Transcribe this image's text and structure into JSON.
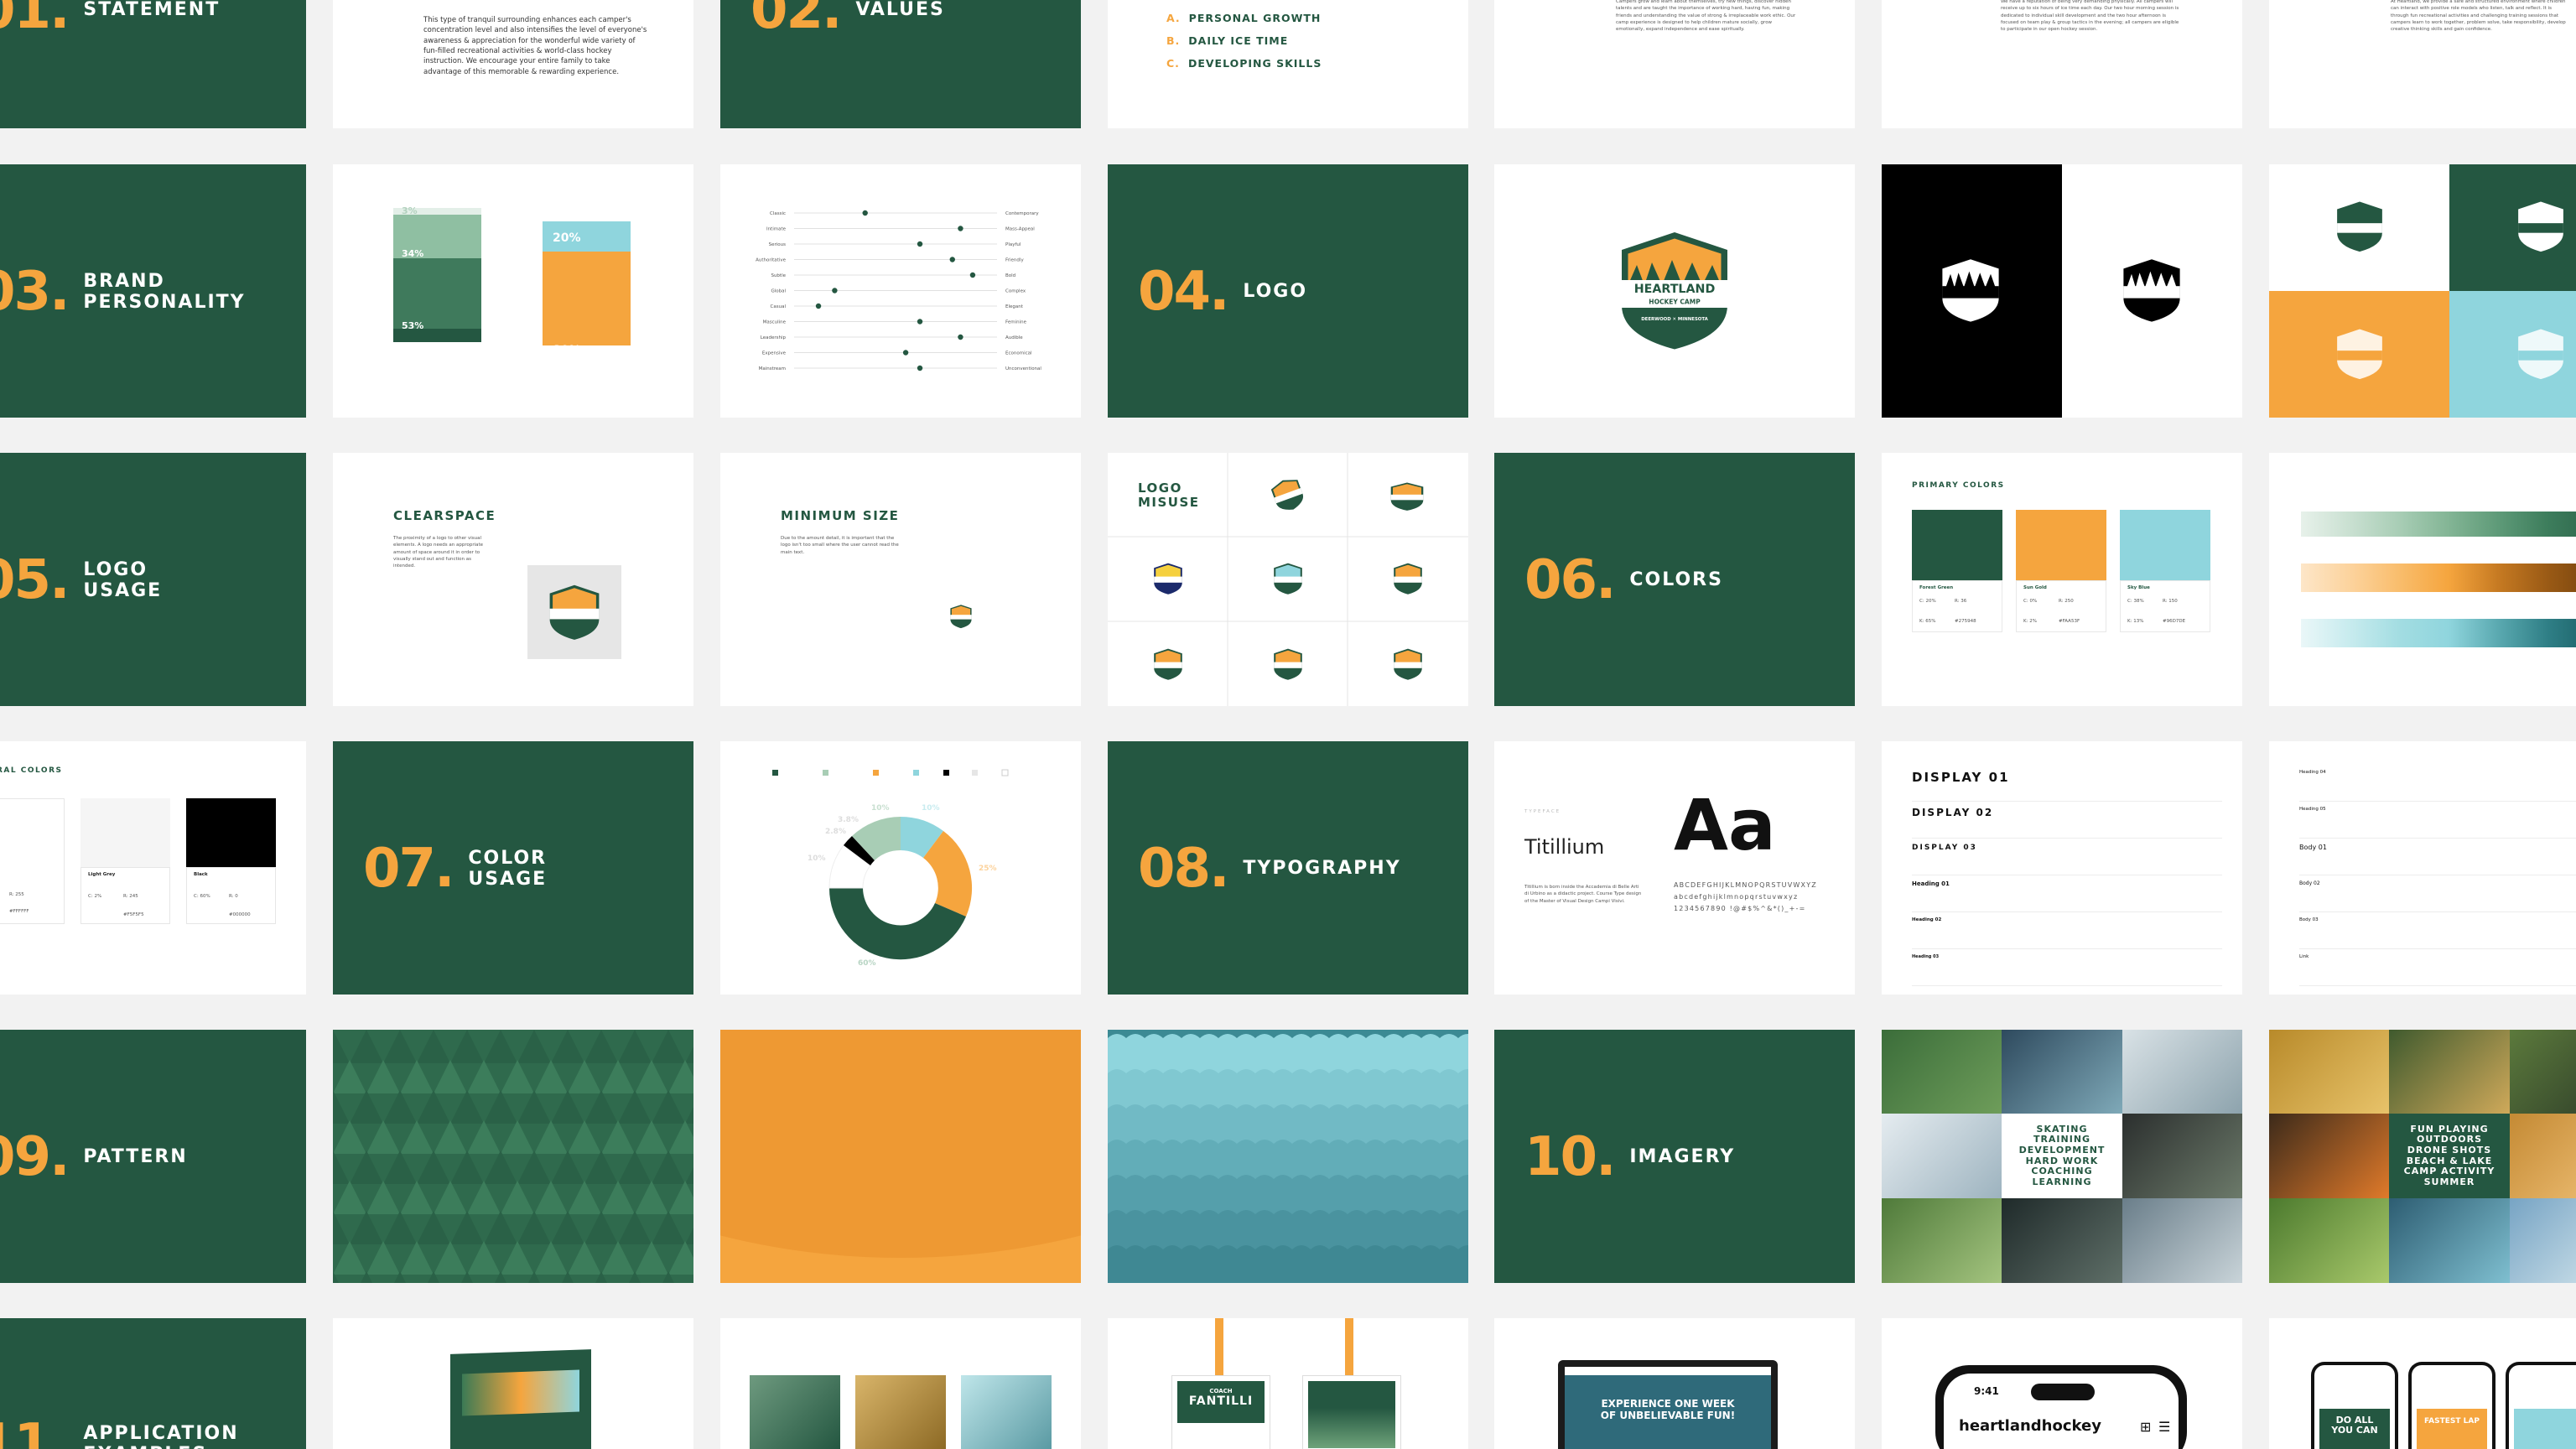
{
  "colors": {
    "forest_green": "#245741",
    "sun_gold": "#f5a53e",
    "sky_blue": "#8fd5dd",
    "black": "#000000",
    "light_grey": "#f5f5f5"
  },
  "row1": {
    "statement_title": "STATEMENT",
    "statement_number": "01.",
    "statement_text": "This type of tranquil surrounding enhances each camper's concentration level and also intensifies the level of everyone's awareness & appreciation for the wonderful wide variety of fun-filled recreational activities & world-class hockey instruction. We encourage your entire family to take advantage of this memorable & rewarding experience.",
    "values_number": "02.",
    "values_title": "VALUES",
    "values": [
      {
        "letter": "A.",
        "label": "PERSONAL GROWTH"
      },
      {
        "letter": "B.",
        "label": "DAILY ICE TIME"
      },
      {
        "letter": "C.",
        "label": "DEVELOPING SKILLS"
      }
    ],
    "value_text_a": "Campers grow and learn about themselves, try new things, discover hidden talents and are taught the importance of working hard, having fun, making friends and understanding the value of strong & irreplaceable work ethic. Our camp experience is designed to help children mature socially, grow emotionally, expand independence and ease spiritually.",
    "value_text_b": "We have a reputation of being very demanding physically. All campers will receive up to six hours of ice time each day. Our two hour morning session is dedicated to individual skill development and the two hour afternoon is focused on team play & group tactics in the evening; all campers are eligible to participate in our open hockey session.",
    "value_text_c": "At Heartland, we provide a safe and structured environment where children can interact with positive role models who listen, talk and reflect. It is through fun recreational activities and challenging training sessions that campers learn to work together, problem solve, take responsibility, develop creative thinking skills and gain confidence."
  },
  "row2": {
    "number": "03.",
    "title": "BRAND\nPERSONALITY",
    "bar_chart": {
      "bars": [
        {
          "segments": [
            {
              "label": "3%",
              "value": 3
            },
            {
              "label": "34%",
              "value": 34
            },
            {
              "label": "53%",
              "value": 53
            },
            {
              "label": "10%",
              "value": 10
            }
          ]
        },
        {
          "segments": [
            {
              "label": "20%",
              "value": 20
            },
            {
              "label": "80%",
              "value": 80
            }
          ]
        }
      ]
    },
    "sliders": [
      {
        "left": "Classic",
        "right": "Contemporary",
        "value": 0.35
      },
      {
        "left": "Intimate",
        "right": "Mass-Appeal",
        "value": 0.82
      },
      {
        "left": "Serious",
        "right": "Playful",
        "value": 0.62
      },
      {
        "left": "Authoritative",
        "right": "Friendly",
        "value": 0.78
      },
      {
        "left": "Subtle",
        "right": "Bold",
        "value": 0.88
      },
      {
        "left": "Global",
        "right": "Complex",
        "value": 0.2
      },
      {
        "left": "Casual",
        "right": "Elegant",
        "value": 0.12
      },
      {
        "left": "Masculine",
        "right": "Feminine",
        "value": 0.62
      },
      {
        "left": "Leadership",
        "right": "Audible",
        "value": 0.82
      },
      {
        "left": "Expensive",
        "right": "Economical",
        "value": 0.55
      },
      {
        "left": "Mainstream",
        "right": "Unconventional",
        "value": 0.62
      }
    ],
    "logo_number": "04.",
    "logo_title": "LOGO",
    "logo_name_line1": "HEARTLAND",
    "logo_name_line2": "HOCKEY CAMP",
    "logo_tagline": "DEERWOOD ✕ MINNESOTA"
  },
  "row3": {
    "number": "05.",
    "title": "LOGO\nUSAGE",
    "clearspace_title": "CLEARSPACE",
    "clearspace_text": "The proximity of a logo to other visual elements. A logo needs an appropriate amount of space around it in order to visually stand out and function as intended.",
    "minsize_title": "MINIMUM SIZE",
    "minsize_text": "Due to the amount detail, it is important that the logo isn't too small where the user cannot read the main text.",
    "misuse_title": "LOGO\nMISUSE",
    "colors_number": "06.",
    "colors_title": "COLORS",
    "primary_title": "PRIMARY COLORS",
    "primary": [
      {
        "name": "Forest Green",
        "c": "C: 20%",
        "m": "M: 0%",
        "y": "Y: 7%",
        "k": "K: 65%",
        "r": "R: 36",
        "g": "G: 89",
        "b": "B: 72",
        "hex": "#275948"
      },
      {
        "name": "Sun Gold",
        "c": "C: 0%",
        "m": "M: 32%",
        "y": "Y: 72%",
        "k": "K: 2%",
        "r": "R: 250",
        "g": "G: 165",
        "b": "B: 63",
        "hex": "#FAA53F"
      },
      {
        "name": "Sky Blue",
        "c": "C: 38%",
        "m": "M: 3%",
        "y": "Y: 0%",
        "k": "K: 13%",
        "r": "R: 150",
        "g": "G: 215",
        "b": "B: 222",
        "hex": "#96D7DE"
      }
    ]
  },
  "row4": {
    "neutral_title": "RAL COLORS",
    "neutrals": [
      {
        "name": "",
        "r": "R: 255",
        "g": "G: 255",
        "b": "B: 255",
        "hex": "#FFFFFF"
      },
      {
        "name": "Light Grey",
        "c": "C: 2%",
        "m": "M: 0%",
        "y": "Y: 0%",
        "k": "K: 4%",
        "r": "R: 245",
        "g": "G: 245",
        "b": "B: 245",
        "hex": "#F5F5F5"
      },
      {
        "name": "Black",
        "c": "C: 60%",
        "m": "M: 40%",
        "y": "Y: 40%",
        "k": "K: 100%",
        "r": "R: 0",
        "g": "G: 0",
        "b": "B: 0",
        "hex": "#000000"
      }
    ],
    "usage_number": "07.",
    "usage_title": "COLOR\nUSAGE",
    "donut": {
      "legend": [
        "Forest Green",
        "Green Tint",
        "Sun Gold",
        "Sky Blue",
        "Black",
        "Light Grey",
        "White"
      ],
      "labels": [
        "10%",
        "10%",
        "3.8%",
        "2.8%",
        "10%",
        "25%",
        "60%"
      ]
    },
    "typo_number": "08.",
    "typo_title": "TYPOGRAPHY",
    "typeface_label": "TYPEFACE",
    "typeface_name": "Titillium",
    "typeface_sample": "Aa",
    "typeface_text": "Titillium is born inside the Accademia di Belle Arti di Urbino as a didactic project. Course Type design of the Master of Visual Design Campi Visivi.",
    "alphabet_upper": "ABCDEFGHIJKLMNOPQRSTUVWXYZ",
    "alphabet_lower": "abcdefghijklmnopqrstuvwxyz",
    "digits": "1234567890 !@#$%^&*()_+-=",
    "type_styles": [
      "DISPLAY 01",
      "DISPLAY 02",
      "DISPLAY 03",
      "Heading 01",
      "Heading 02",
      "Heading 03"
    ],
    "body_styles": [
      "Heading 04",
      "Heading 05",
      "Body 01",
      "Body 02",
      "Body 03",
      "Link"
    ]
  },
  "row5": {
    "pattern_number": "09.",
    "pattern_title": "PATTERN",
    "imagery_number": "10.",
    "imagery_title": "IMAGERY",
    "imagery_words": "SKATING\nTRAINING\nDEVELOPMENT\nHARD WORK\nCOACHING\nLEARNING",
    "imagery_words_2": "FUN PLAYING\nOUTDOORS\nDRONE SHOTS\nBEACH & LAKE\nCAMP ACTIVITY\nSUMMER"
  },
  "row6": {
    "app_number": "11.",
    "app_title": "APPLICATION\nEXAMPLES",
    "badge_name": "FANTILLI",
    "badge_role": "COACH",
    "web_headline": "EXPERIENCE ONE WEEK\nOF UNBELIEVABLE FUN!",
    "phone_time": "9:41",
    "phone_handle": "heartlandhockey",
    "insta_1": "DO ALL\nYOU CAN",
    "insta_2": "FASTEST LAP"
  }
}
